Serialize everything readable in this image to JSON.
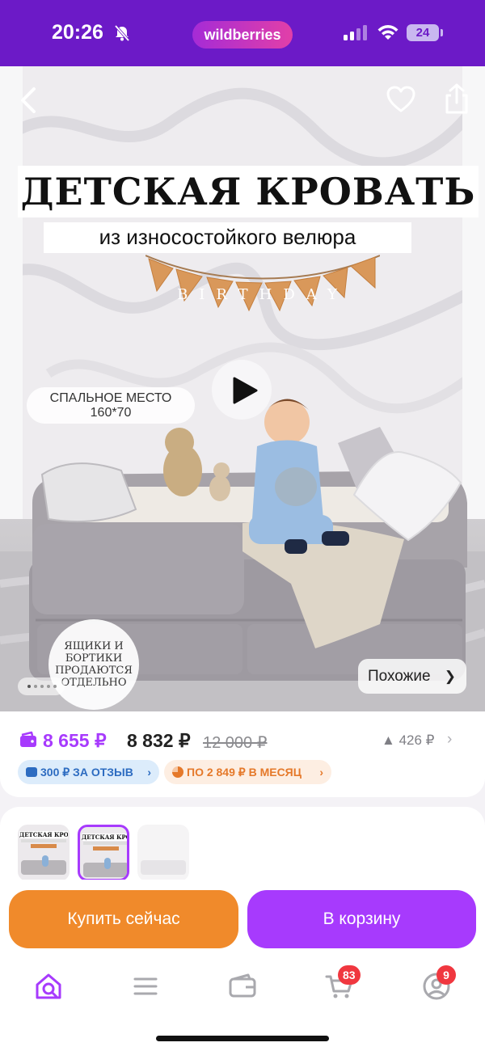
{
  "status_bar": {
    "time": "20:26",
    "brand": "wildberries",
    "battery": "24"
  },
  "hero": {
    "title": "ДЕТСКАЯ КРОВАТЬ",
    "subtitle": "из износостойкого велюра",
    "bunting_text": "BIRTHDAY",
    "sleep_line1": "СПАЛЬНОЕ МЕСТО",
    "sleep_line2": "160*70",
    "badge_lines": [
      "ЯЩИКИ И",
      "БОРТИКИ",
      "ПРОДАЮТСЯ",
      "ОТДЕЛЬНО"
    ],
    "similar_label": "Похожие",
    "slide_index": 1,
    "slide_count": 5
  },
  "price": {
    "wallet_price": "8 655 ₽",
    "current_price": "8 832 ₽",
    "old_price": "12 000 ₽",
    "trend": "426 ₽",
    "review_bonus": "300 ₽ ЗА ОТЗЫВ",
    "installment": "ПО 2 849 ₽ В МЕСЯЦ"
  },
  "thumbnails": [
    {
      "title": "ДЕТСКАЯ КРОВАТЬ"
    },
    {
      "title": "ДЕТСКАЯ КРОВАТЬ"
    },
    {
      "title": ""
    }
  ],
  "actions": {
    "buy_now": "Купить сейчас",
    "add_to_cart": "В корзину"
  },
  "tab_bar": {
    "cart_count": "83",
    "profile_count": "9"
  },
  "colors": {
    "brand_purple": "#6c1ac7",
    "accent_purple": "#a73afd",
    "buy_orange": "#f08a2b",
    "badge_red": "#f0373f"
  },
  "icons": [
    "chevron-left-icon",
    "heart-icon",
    "share-icon",
    "play-icon",
    "wallet-icon",
    "home-search-icon",
    "menu-icon",
    "wallet-tab-icon",
    "cart-icon",
    "profile-icon"
  ]
}
